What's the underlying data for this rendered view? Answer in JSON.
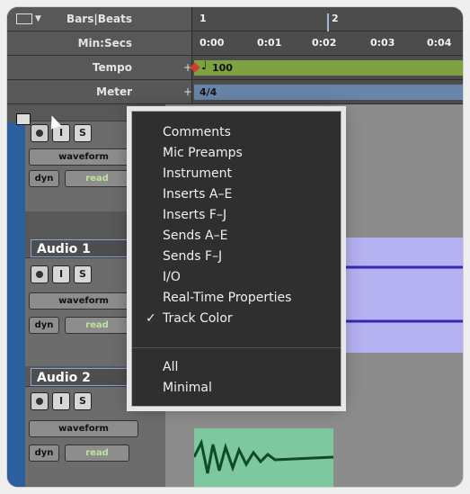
{
  "rulers": {
    "bars_beats": {
      "label": "Bars|Beats",
      "ticks": [
        "1",
        "2"
      ]
    },
    "min_secs": {
      "label": "Min:Secs",
      "ticks": [
        "0:00",
        "0:01",
        "0:02",
        "0:03",
        "0:04"
      ]
    },
    "tempo": {
      "label": "Tempo",
      "value": "100"
    },
    "meter": {
      "label": "Meter",
      "value": "4/4"
    }
  },
  "tracks": [
    {
      "name": "",
      "view": "waveform",
      "automation_mode": "read",
      "btn_i": "I",
      "btn_s": "S",
      "dyn": "dyn",
      "clip_color": "#e6b6c8",
      "wave_color": "#b2174f"
    },
    {
      "name": "Audio 1",
      "view": "waveform",
      "automation_mode": "read",
      "btn_i": "I",
      "btn_s": "S",
      "dyn": "dyn",
      "clip_color": "#b6b2f1",
      "wave_color": "#2f2bb8"
    },
    {
      "name": "Audio 2",
      "view": "waveform",
      "automation_mode": "read",
      "btn_i": "I",
      "btn_s": "S",
      "dyn": "dyn",
      "clip_color": "#7dc89e",
      "wave_color": "#0e4c25"
    }
  ],
  "menu": {
    "items": [
      {
        "label": "Comments",
        "checked": false
      },
      {
        "label": "Mic Preamps",
        "checked": false
      },
      {
        "label": "Instrument",
        "checked": false
      },
      {
        "label": "Inserts A–E",
        "checked": false
      },
      {
        "label": "Inserts F–J",
        "checked": false
      },
      {
        "label": "Sends A–E",
        "checked": false
      },
      {
        "label": "Sends F–J",
        "checked": false
      },
      {
        "label": "I/O",
        "checked": false
      },
      {
        "label": "Real-Time Properties",
        "checked": false
      },
      {
        "label": "Track Color",
        "checked": true
      }
    ],
    "presets": [
      {
        "label": "All"
      },
      {
        "label": "Minimal"
      }
    ],
    "check_mark": "✓"
  }
}
